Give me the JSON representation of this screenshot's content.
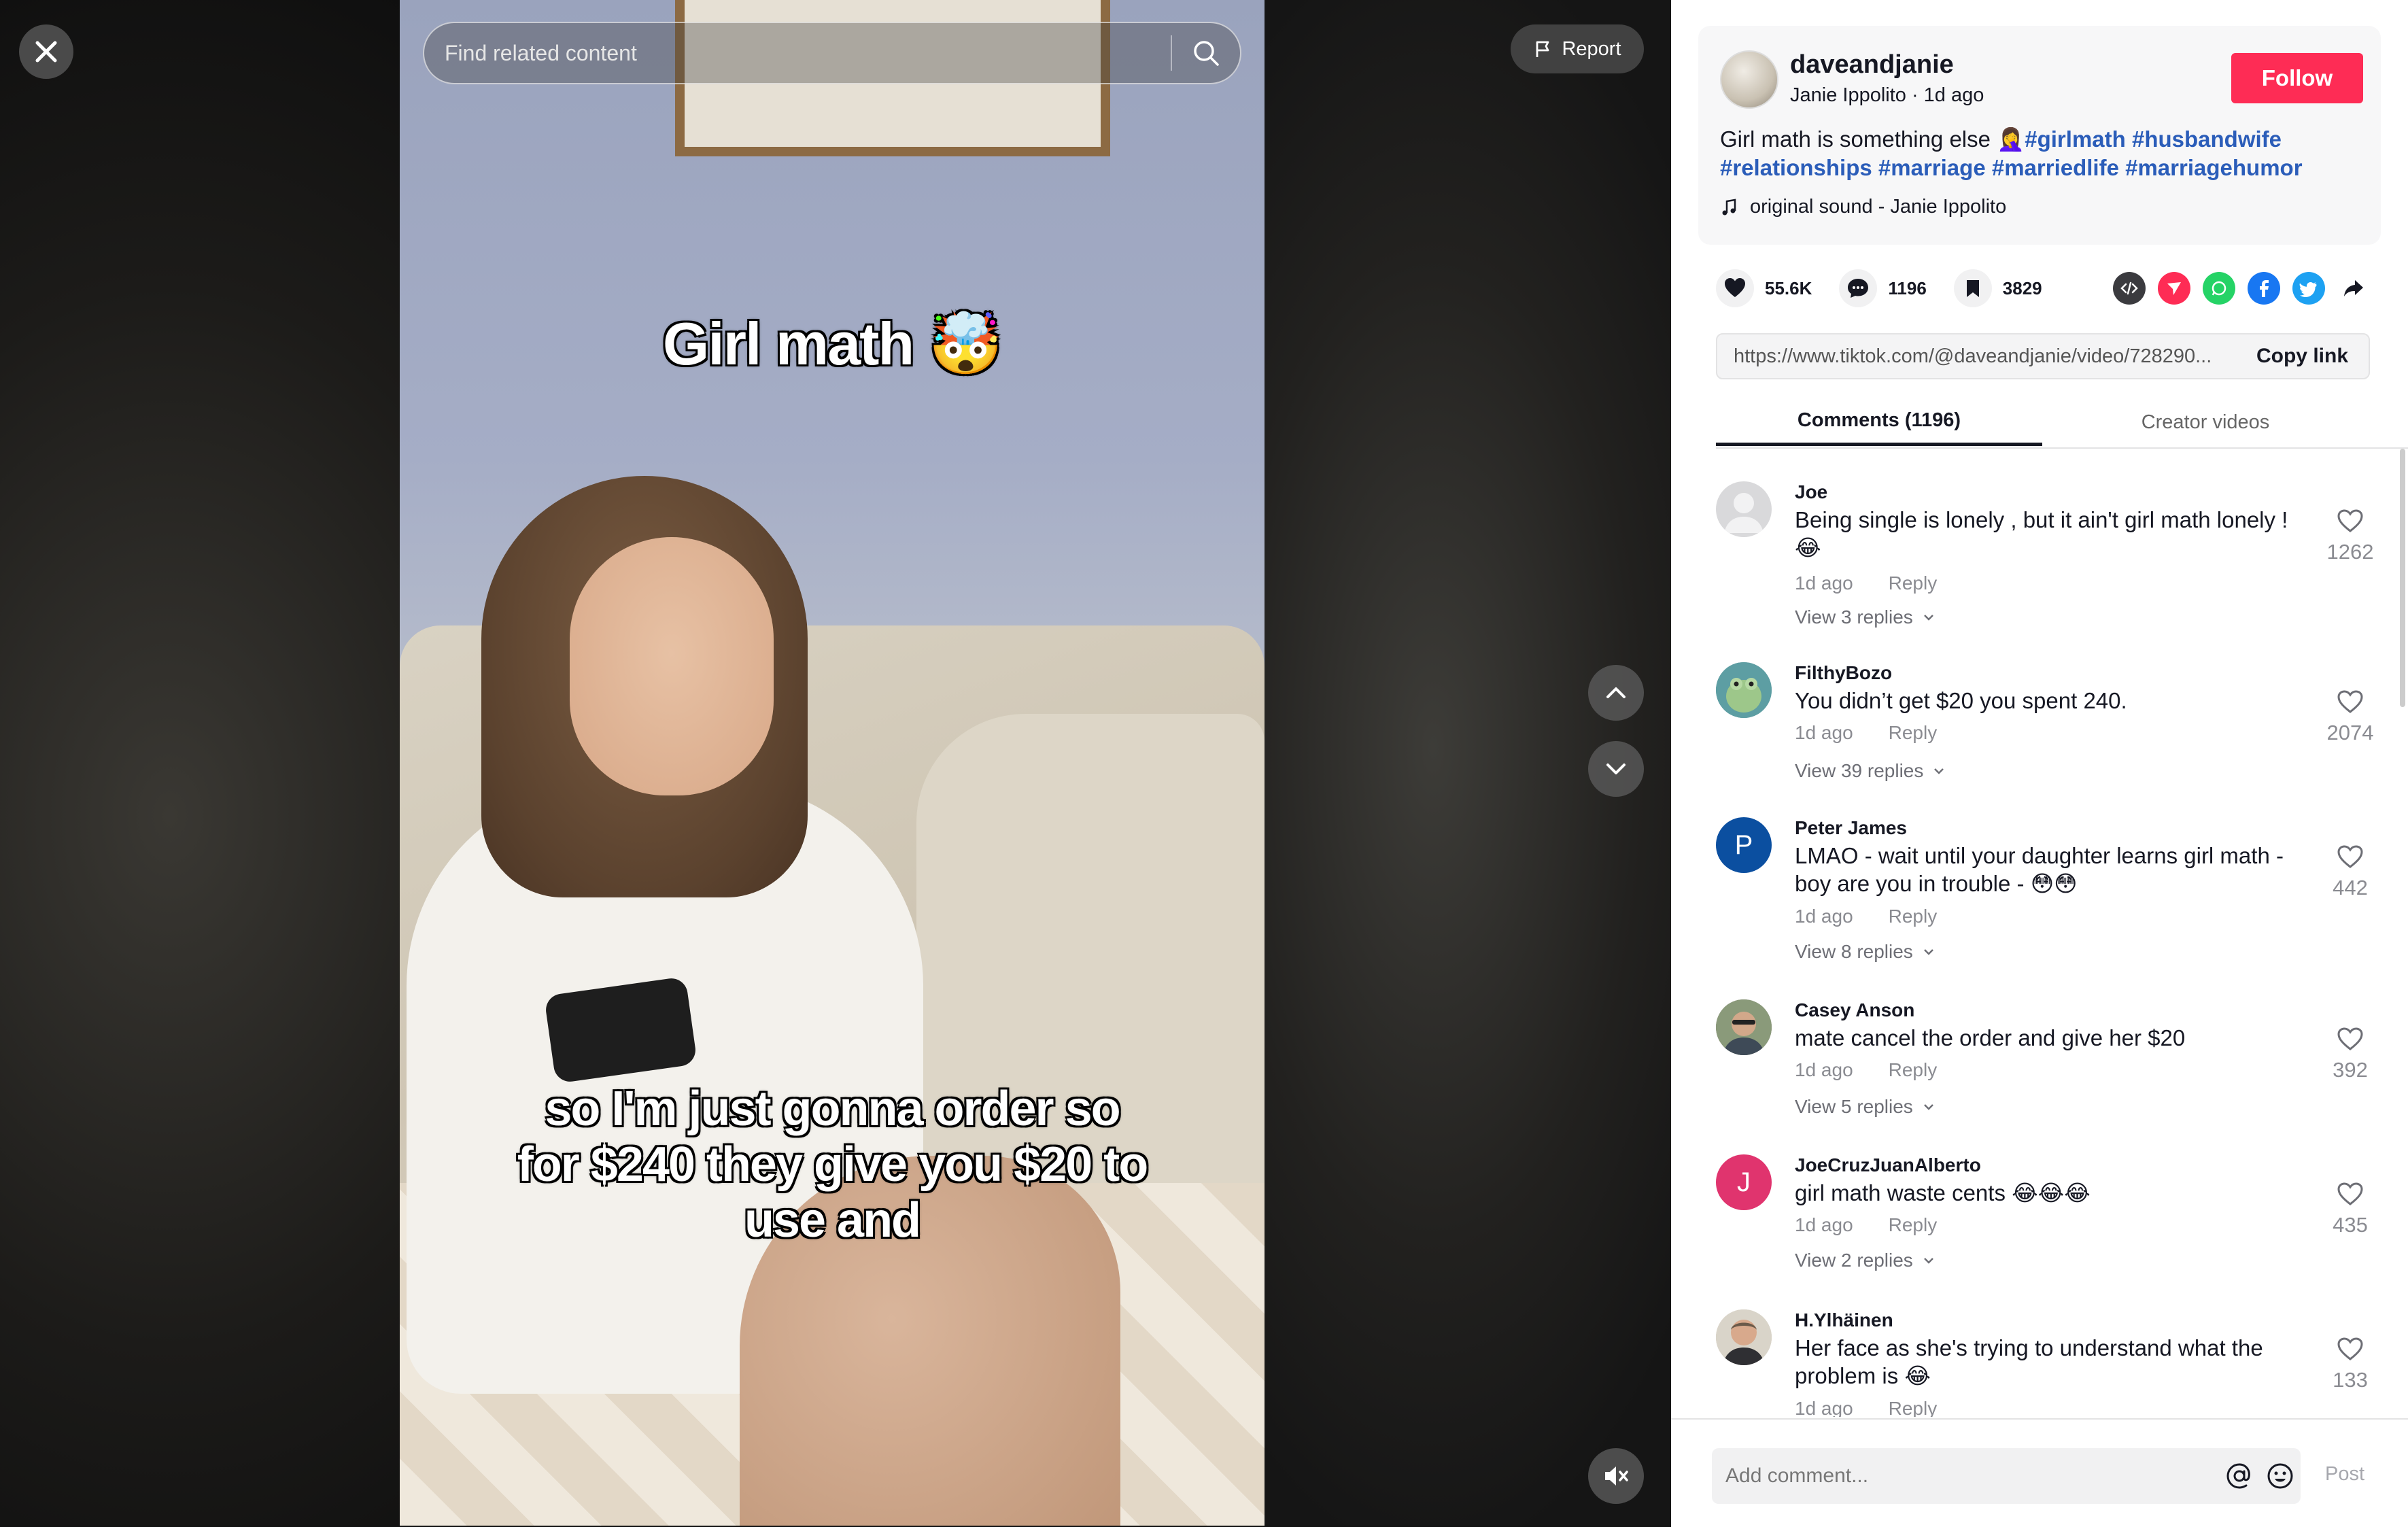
{
  "video": {
    "search_placeholder": "Find related content",
    "report_label": "Report",
    "caption_top": "Girl math 🤯",
    "caption_bottom": "so I'm just gonna order so for $240 they give you $20 to use and"
  },
  "author": {
    "username": "daveandjanie",
    "subline": "Janie Ippolito · 1d ago",
    "follow_label": "Follow",
    "description_text": "Girl math is something else 🤦‍♀️",
    "hashtags": [
      "#girlmath",
      "#husbandwife",
      "#relationships",
      "#marriage",
      "#marriedlife",
      "#marriagehumor"
    ],
    "sound": "original sound - Janie Ippolito"
  },
  "stats": {
    "likes": "55.6K",
    "comments": "1196",
    "saves": "3829"
  },
  "share": {
    "icons": [
      "embed-icon",
      "send-icon",
      "whatsapp-icon",
      "facebook-icon",
      "twitter-icon",
      "share-arrow-icon"
    ],
    "link": "https://www.tiktok.com/@daveandjanie/video/728290...",
    "copy_label": "Copy link"
  },
  "tabs": {
    "comments": "Comments (1196)",
    "creator": "Creator videos"
  },
  "comments": [
    {
      "name": "Joe",
      "text": "Being single is lonely , but it ain't girl math lonely ! 😂",
      "time": "1d ago",
      "reply": "Reply",
      "view": "View 3 replies",
      "likes": "1262",
      "avatar": "default"
    },
    {
      "name": "FilthyBozo",
      "text": "You didn’t get $20 you spent 240.",
      "time": "1d ago",
      "reply": "Reply",
      "view": "View 39 replies",
      "likes": "2074",
      "avatar": "frog"
    },
    {
      "name": "Peter James",
      "text": "LMAO - wait until your daughter learns girl math - boy are you in trouble - 😳😳",
      "time": "1d ago",
      "reply": "Reply",
      "view": "View 8 replies",
      "likes": "442",
      "avatar_letter": "P"
    },
    {
      "name": "Casey Anson",
      "text": "mate cancel the order and give her $20",
      "time": "1d ago",
      "reply": "Reply",
      "view": "View 5 replies",
      "likes": "392",
      "avatar": "photo"
    },
    {
      "name": "JoeCruzJuanAlberto",
      "text": "girl math waste cents 😂😂😂",
      "time": "1d ago",
      "reply": "Reply",
      "view": "View 2 replies",
      "likes": "435",
      "avatar_letter": "J"
    },
    {
      "name": "H.Ylhäinen",
      "text": "Her face as she's trying to understand what the problem is 😂",
      "time": "1d ago",
      "reply": "Reply",
      "likes": "133",
      "avatar": "photo"
    }
  ],
  "comment_bar": {
    "placeholder": "Add comment...",
    "post_label": "Post"
  },
  "colors": {
    "follow": "#fe2c55",
    "hashtag": "#2b5db9",
    "peter_avatar": "#0b4fa0",
    "joecruz_avatar": "#e0346e"
  }
}
